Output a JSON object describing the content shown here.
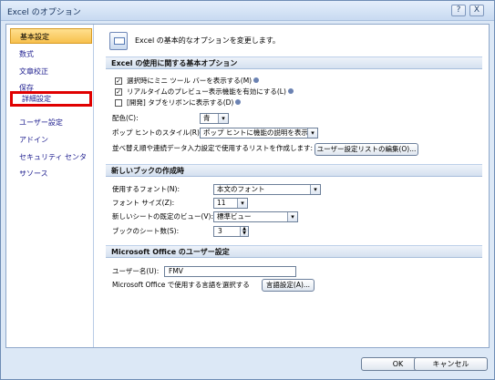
{
  "window": {
    "title": "Excel のオプション",
    "help_symbol": "?",
    "close_symbol": "X"
  },
  "sidebar": {
    "items": [
      {
        "label": "基本設定"
      },
      {
        "label": "数式"
      },
      {
        "label": "文章校正"
      },
      {
        "label": "保存"
      },
      {
        "label": "詳細設定"
      },
      {
        "label": "ユーザー設定"
      },
      {
        "label": "アドイン"
      },
      {
        "label": "セキュリティ センター"
      },
      {
        "label": "リソース"
      }
    ]
  },
  "panel": {
    "header": "Excel の基本的なオプションを変更します。",
    "sections": {
      "basic": "Excel の使用に関する基本オプション",
      "new_book": "新しいブックの作成時",
      "user": "Microsoft Office のユーザー設定"
    },
    "checkboxes": [
      {
        "label": "選択時にミニ ツール バーを表示する(M)",
        "checked": true,
        "mark": "✓"
      },
      {
        "label": "リアルタイムのプレビュー表示機能を有効にする(L)",
        "checked": true,
        "mark": "✓"
      },
      {
        "label": "[開発] タブをリボンに表示する(D)",
        "checked": false,
        "mark": ""
      }
    ],
    "color": {
      "label": "配色(C):",
      "value": "青"
    },
    "tooltip": {
      "label": "ポップ ヒントのスタイル(R):",
      "value": "ポップ ヒントに機能の説明を表示する"
    },
    "sort": {
      "label": "並べ替え順や連続データ入力設定で使用するリストを作成します:",
      "button": "ユーザー設定リストの編集(O)..."
    },
    "new_book": {
      "font": {
        "label": "使用するフォント(N):",
        "value": "本文のフォント"
      },
      "size": {
        "label": "フォント サイズ(Z):",
        "value": "11"
      },
      "view": {
        "label": "新しいシートの既定のビュー(V):",
        "value": "標準ビュー"
      },
      "sheets": {
        "label": "ブックのシート数(S):",
        "value": "3"
      }
    },
    "user": {
      "name_label": "ユーザー名(U):",
      "name_value": "FMV",
      "lang_label": "Microsoft Office で使用する言語を選択する",
      "lang_button": "言語設定(A)..."
    }
  },
  "footer": {
    "ok": "OK",
    "cancel": "キャンセル"
  },
  "icons": {
    "dropdown": "▾",
    "spin_up": "▲",
    "spin_down": "▼"
  },
  "colors": {
    "selected_nav": "#f7c04d",
    "highlight_box": "#e00000",
    "link_text": "#1c1c8e"
  }
}
